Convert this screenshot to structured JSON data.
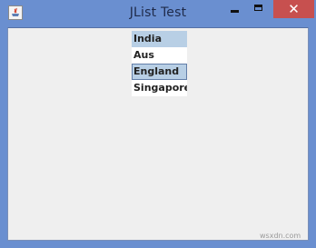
{
  "window": {
    "title": "JList Test",
    "close_symbol": "✕",
    "icon": "java-app-icon"
  },
  "list": {
    "items": [
      {
        "label": "India",
        "selected": true
      },
      {
        "label": "Aus",
        "selected": false
      },
      {
        "label": "England",
        "selected": true,
        "focused": true
      },
      {
        "label": "Singapore",
        "selected": false
      }
    ]
  },
  "watermark": {
    "text": "wsxdn.com"
  },
  "colors": {
    "titlebar": "#6a8fd0",
    "close_button": "#c7504f",
    "selection": "#b8cfe5",
    "content_background": "#efefef"
  }
}
